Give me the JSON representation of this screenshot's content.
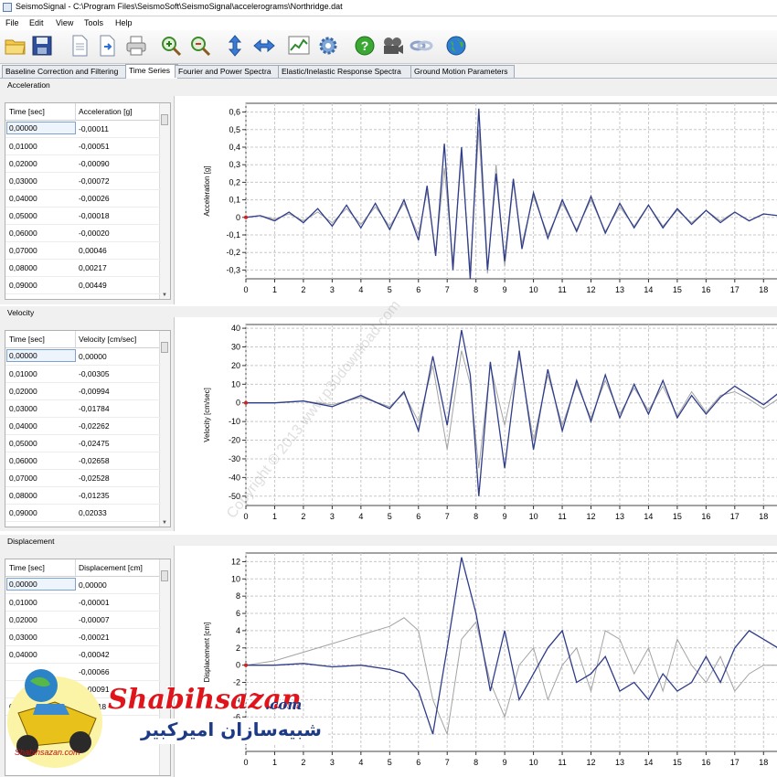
{
  "window": {
    "title": "SeismoSignal - C:\\Program Files\\SeismoSoft\\SeismoSignal\\accelerograms\\Northridge.dat"
  },
  "menu": [
    "File",
    "Edit",
    "View",
    "Tools",
    "Help"
  ],
  "toolbar": {
    "icons": [
      "open-folder-icon",
      "save-disk-icon",
      "new-document-icon",
      "import-document-icon",
      "print-icon",
      "zoom-in-icon",
      "zoom-out-icon",
      "vertical-arrows-icon",
      "horizontal-arrows-icon",
      "chart-icon",
      "gear-icon",
      "help-icon",
      "film-icon",
      "link-icon",
      "globe-icon"
    ]
  },
  "tabs": [
    {
      "label": "Baseline Correction and Filtering",
      "active": false
    },
    {
      "label": "Time Series",
      "active": true
    },
    {
      "label": "Fourier and Power Spectra",
      "active": false
    },
    {
      "label": "Elastic/Inelastic Response Spectra",
      "active": false
    },
    {
      "label": "Ground Motion Parameters",
      "active": false
    }
  ],
  "panels": [
    {
      "title": "Acceleration",
      "col1": "Time [sec]",
      "col2": "Acceleration [g]",
      "rows": [
        [
          "0,00000",
          "-0,00011"
        ],
        [
          "0,01000",
          "-0,00051"
        ],
        [
          "0,02000",
          "-0,00090"
        ],
        [
          "0,03000",
          "-0,00072"
        ],
        [
          "0,04000",
          "-0,00026"
        ],
        [
          "0,05000",
          "-0,00018"
        ],
        [
          "0,06000",
          "-0,00020"
        ],
        [
          "0,07000",
          "0,00046"
        ],
        [
          "0,08000",
          "0,00217"
        ],
        [
          "0,09000",
          "0,00449"
        ]
      ]
    },
    {
      "title": "Velocity",
      "col1": "Time [sec]",
      "col2": "Velocity [cm/sec]",
      "rows": [
        [
          "0,00000",
          "0,00000"
        ],
        [
          "0,01000",
          "-0,00305"
        ],
        [
          "0,02000",
          "-0,00994"
        ],
        [
          "0,03000",
          "-0,01784"
        ],
        [
          "0,04000",
          "-0,02262"
        ],
        [
          "0,05000",
          "-0,02475"
        ],
        [
          "0,06000",
          "-0,02658"
        ],
        [
          "0,07000",
          "-0,02528"
        ],
        [
          "0,08000",
          "-0,01235"
        ],
        [
          "0,09000",
          "0,02033"
        ]
      ]
    },
    {
      "title": "Displacement",
      "col1": "Time [sec]",
      "col2": "Displacement [cm]",
      "rows": [
        [
          "0,00000",
          "0,00000"
        ],
        [
          "0,01000",
          "-0,00001"
        ],
        [
          "0,02000",
          "-0,00007"
        ],
        [
          "0,03000",
          "-0,00021"
        ],
        [
          "0,04000",
          "-0,00042"
        ],
        [
          "",
          "-0,00066"
        ],
        [
          "",
          "-0,00091"
        ],
        [
          "0,07000",
          "0,00118"
        ]
      ]
    }
  ],
  "chart_data": [
    {
      "type": "line",
      "ylabel": "Acceleration [g]",
      "xlim": [
        0,
        18.5
      ],
      "ylim": [
        -0.35,
        0.65
      ],
      "yticks": [
        "0,6",
        "0,5",
        "0,4",
        "0,3",
        "0,2",
        "0,1",
        "0",
        "-0,1",
        "-0,2",
        "-0,3"
      ],
      "xticks": [
        "0",
        "1",
        "2",
        "3",
        "4",
        "5",
        "6",
        "7",
        "8",
        "9",
        "10",
        "11",
        "12",
        "13",
        "14",
        "15",
        "16",
        "17",
        "18"
      ],
      "grid": true,
      "series": [
        {
          "color": "#a3a3a3",
          "x": [
            0,
            0.5,
            1,
            1.5,
            2,
            2.5,
            3,
            3.5,
            4,
            4.5,
            5,
            5.5,
            6,
            6.3,
            6.6,
            6.9,
            7.2,
            7.5,
            7.8,
            8.1,
            8.4,
            8.7,
            9,
            9.3,
            9.6,
            10,
            10.5,
            11,
            11.5,
            12,
            12.5,
            13,
            13.5,
            14,
            14.5,
            15,
            15.5,
            16,
            16.5,
            17,
            17.5,
            18,
            18.5
          ],
          "y": [
            0,
            0.01,
            -0.01,
            0.02,
            -0.02,
            0.03,
            -0.03,
            0.05,
            -0.04,
            0.06,
            -0.05,
            0.08,
            -0.1,
            0.15,
            -0.2,
            0.28,
            -0.25,
            0.35,
            -0.3,
            0.5,
            -0.32,
            0.3,
            -0.28,
            0.2,
            -0.15,
            0.12,
            -0.1,
            0.08,
            -0.07,
            0.1,
            -0.08,
            0.06,
            -0.05,
            0.07,
            -0.05,
            0.04,
            -0.03,
            0.04,
            -0.02,
            0.03,
            -0.02,
            0.02,
            0.01
          ]
        },
        {
          "color": "#2f3c8a",
          "x": [
            0,
            0.5,
            1,
            1.5,
            2,
            2.5,
            3,
            3.5,
            4,
            4.5,
            5,
            5.5,
            6,
            6.3,
            6.6,
            6.9,
            7.2,
            7.5,
            7.8,
            8.1,
            8.4,
            8.7,
            9,
            9.3,
            9.6,
            10,
            10.5,
            11,
            11.5,
            12,
            12.5,
            13,
            13.5,
            14,
            14.5,
            15,
            15.5,
            16,
            16.5,
            17,
            17.5,
            18,
            18.5
          ],
          "y": [
            0,
            0.01,
            -0.02,
            0.03,
            -0.03,
            0.05,
            -0.05,
            0.07,
            -0.06,
            0.08,
            -0.07,
            0.1,
            -0.13,
            0.18,
            -0.22,
            0.42,
            -0.3,
            0.4,
            -0.35,
            0.62,
            -0.3,
            0.25,
            -0.25,
            0.22,
            -0.18,
            0.14,
            -0.12,
            0.1,
            -0.08,
            0.12,
            -0.09,
            0.08,
            -0.06,
            0.07,
            -0.06,
            0.05,
            -0.04,
            0.04,
            -0.03,
            0.03,
            -0.02,
            0.02,
            0.01
          ]
        }
      ]
    },
    {
      "type": "line",
      "ylabel": "Velocity [cm/sec]",
      "xlim": [
        0,
        18.5
      ],
      "ylim": [
        -55,
        42
      ],
      "yticks": [
        "40",
        "30",
        "20",
        "10",
        "0",
        "-10",
        "-20",
        "-30",
        "-40",
        "-50"
      ],
      "xticks": [
        "0",
        "1",
        "2",
        "3",
        "4",
        "5",
        "6",
        "7",
        "8",
        "9",
        "10",
        "11",
        "12",
        "13",
        "14",
        "15",
        "16",
        "17",
        "18"
      ],
      "grid": true,
      "series": [
        {
          "color": "#a3a3a3",
          "x": [
            0,
            1,
            2,
            3,
            4,
            5,
            5.5,
            6,
            6.5,
            7,
            7.5,
            7.8,
            8.1,
            8.5,
            9,
            9.5,
            10,
            10.5,
            11,
            11.5,
            12,
            12.5,
            13,
            13.5,
            14,
            14.5,
            15,
            15.5,
            16,
            16.5,
            17,
            17.5,
            18,
            18.5
          ],
          "y": [
            0,
            0,
            1,
            -1,
            3,
            -2,
            5,
            -10,
            20,
            -25,
            28,
            10,
            -35,
            20,
            -12,
            25,
            -20,
            15,
            -12,
            10,
            -8,
            12,
            -6,
            8,
            -4,
            9,
            -7,
            6,
            -5,
            4,
            6,
            2,
            -3,
            2
          ]
        },
        {
          "color": "#2f3c8a",
          "x": [
            0,
            1,
            2,
            3,
            4,
            5,
            5.5,
            6,
            6.5,
            7,
            7.5,
            7.8,
            8.1,
            8.5,
            9,
            9.5,
            10,
            10.5,
            11,
            11.5,
            12,
            12.5,
            13,
            13.5,
            14,
            14.5,
            15,
            15.5,
            16,
            16.5,
            17,
            17.5,
            18,
            18.5
          ],
          "y": [
            0,
            0,
            1,
            -2,
            4,
            -3,
            6,
            -15,
            25,
            -12,
            39,
            15,
            -50,
            22,
            -35,
            28,
            -25,
            18,
            -15,
            12,
            -10,
            15,
            -8,
            10,
            -6,
            12,
            -8,
            4,
            -6,
            3,
            9,
            4,
            -1,
            5
          ]
        }
      ]
    },
    {
      "type": "line",
      "ylabel": "Displacement [cm]",
      "xlim": [
        0,
        18.5
      ],
      "ylim": [
        -10,
        13
      ],
      "yticks": [
        "12",
        "10",
        "8",
        "6",
        "4",
        "2",
        "0",
        "-2",
        "-4",
        "-6",
        "-8"
      ],
      "xticks": [
        "0",
        "1",
        "2",
        "3",
        "4",
        "5",
        "6",
        "7",
        "8",
        "9",
        "10",
        "11",
        "12",
        "13",
        "14",
        "15",
        "16",
        "17",
        "18"
      ],
      "grid": true,
      "series": [
        {
          "color": "#a3a3a3",
          "x": [
            0,
            1,
            2,
            3,
            4,
            5,
            5.5,
            6,
            6.5,
            7,
            7.5,
            8,
            8.5,
            9,
            9.5,
            10,
            10.5,
            11,
            11.5,
            12,
            12.5,
            13,
            13.5,
            14,
            14.5,
            15,
            15.5,
            16,
            16.5,
            17,
            17.5,
            18,
            18.5
          ],
          "y": [
            0,
            0.5,
            1.5,
            2.5,
            3.5,
            4.5,
            5.5,
            4,
            -4,
            -8,
            3,
            5,
            -2,
            -6,
            0,
            2,
            -4,
            0,
            2,
            -3,
            4,
            3,
            -1,
            2,
            -3,
            3,
            0,
            -2,
            1,
            -3,
            -1,
            0,
            0
          ]
        },
        {
          "color": "#2f3c8a",
          "x": [
            0,
            1,
            2,
            3,
            4,
            5,
            5.5,
            6,
            6.5,
            7,
            7.5,
            8,
            8.5,
            9,
            9.5,
            10,
            10.5,
            11,
            11.5,
            12,
            12.5,
            13,
            13.5,
            14,
            14.5,
            15,
            15.5,
            16,
            16.5,
            17,
            17.5,
            18,
            18.5
          ],
          "y": [
            0,
            0,
            0.2,
            -0.2,
            0,
            -0.5,
            -1,
            -3,
            -8,
            2,
            12.5,
            6,
            -3,
            4,
            -4,
            -1,
            2,
            4,
            -2,
            -1,
            1,
            -3,
            -2,
            -4,
            -1,
            -3,
            -2,
            1,
            -2,
            2,
            4,
            3,
            2
          ]
        }
      ]
    }
  ],
  "watermark": "Copyright © 2013 www.p30download.com",
  "logo": {
    "brand": "Shabihsazan",
    "brand_suffix": ".com",
    "fa_text": "شبیه‌سازان امیرکبیر",
    "small": "Shabihsazan.com"
  }
}
